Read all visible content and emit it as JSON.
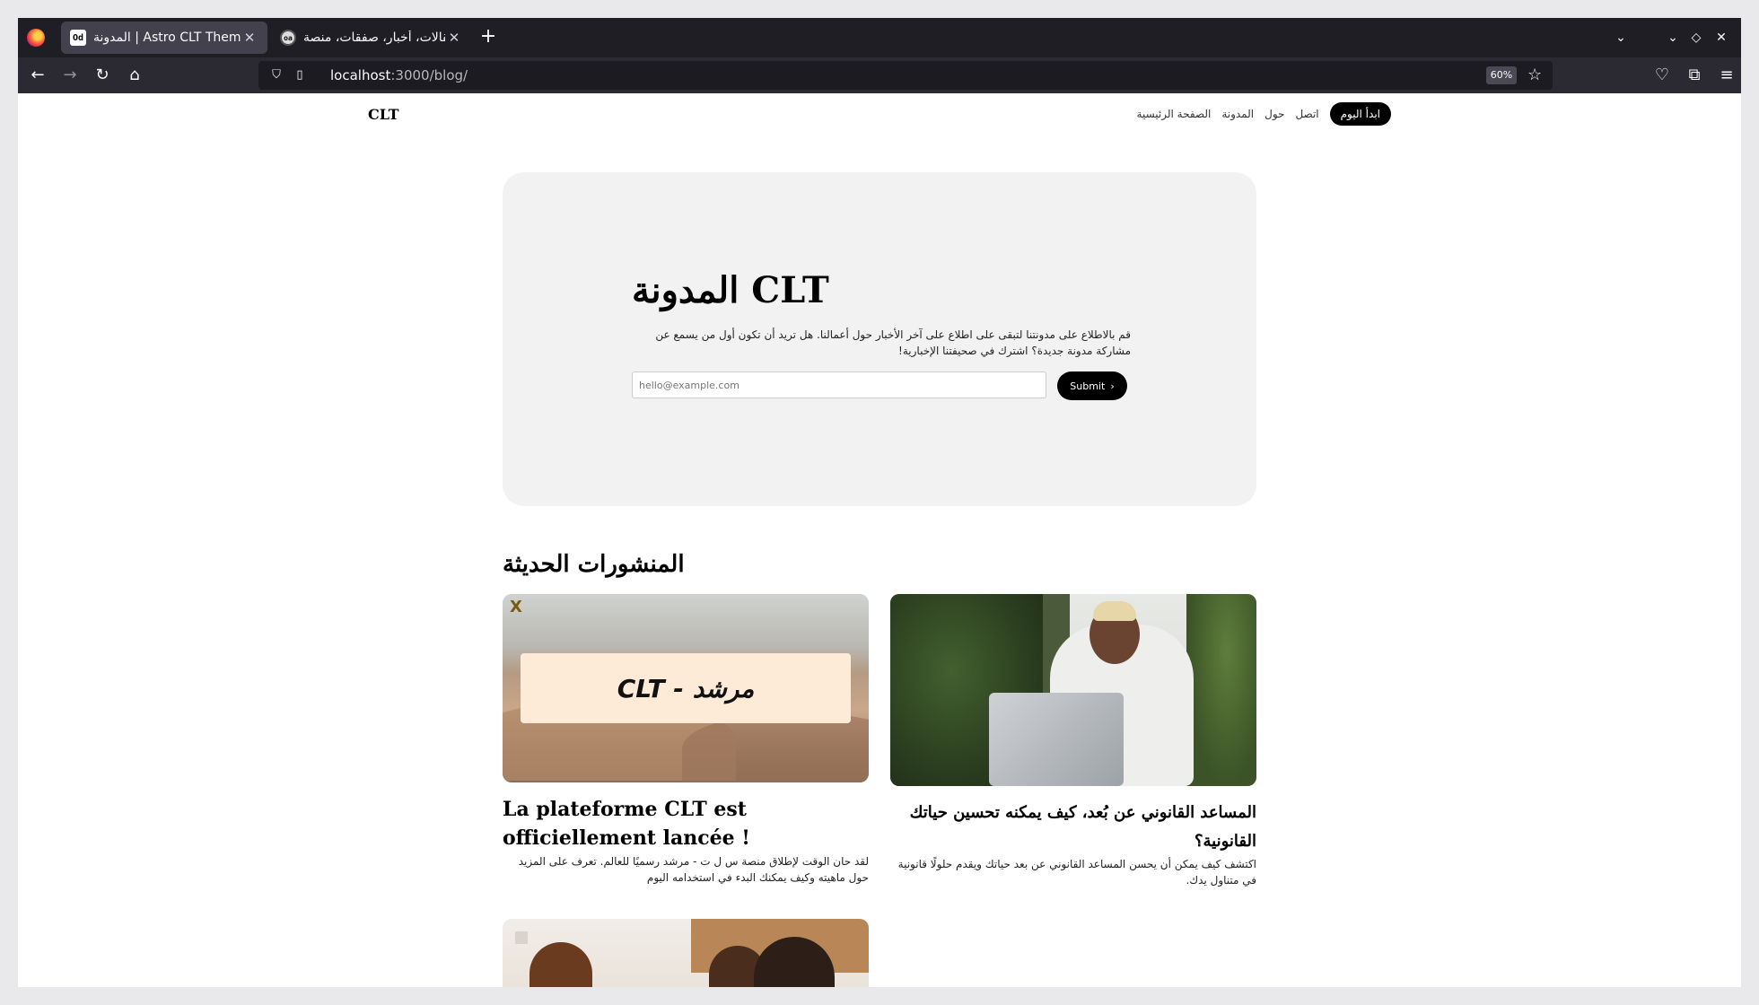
{
  "browser": {
    "tabs": [
      {
        "title": "المدونة | Astro CLT Theme",
        "favicon": "Od",
        "active": true
      },
      {
        "title": "مقالات، أخبار، صفقات، منصة",
        "favicon": "oa",
        "active": false
      }
    ],
    "url_host": "localhost",
    "url_path": ":3000/blog/",
    "zoom": "60%"
  },
  "site": {
    "logo": "CLT",
    "nav": {
      "cta": "ابدأ اليوم",
      "links": [
        "اتصل",
        "حول",
        "المدونة",
        "الصفحة الرئيسية"
      ]
    }
  },
  "hero": {
    "title": "المدونة CLT",
    "description": "قم بالاطلاع على مدونتنا لتبقى على اطلاع على آخر الأخبار حول أعمالنا. هل تريد أن تكون أول من يسمع عن مشاركة مدونة جديدة؟ اشترك في صحيفتنا الإخبارية!",
    "email_placeholder": "hello@example.com",
    "submit_label": "Submit"
  },
  "recent": {
    "heading": "المنشورات الحديثة",
    "posts": [
      {
        "image_caption": "CLT - مرشد",
        "image_mark": "X",
        "title": "La plateforme CLT est officiellement lancée !",
        "description": "لقد حان الوقت لإطلاق منصة س ل ت - مرشد رسميًا للعالم. تعرف على المزيد حول ماهيته وكيف يمكنك البدء في استخدامه اليوم"
      },
      {
        "title": "المساعد القانوني عن بُعد، كيف يمكنه تحسين حياتك القانونية؟",
        "description": "اكتشف كيف يمكن أن يحسن المساعد القانوني عن بعد حياتك ويقدم حلولًا قانونية في متناول يدك."
      }
    ]
  }
}
